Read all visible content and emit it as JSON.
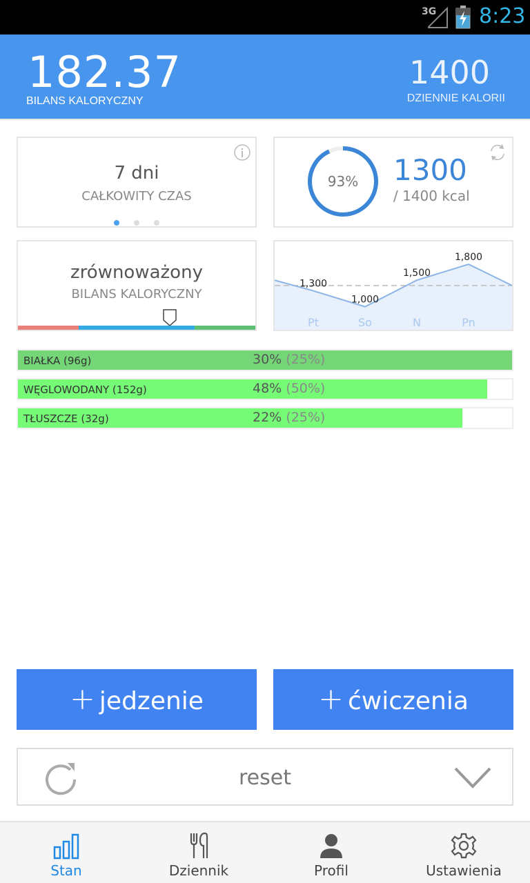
{
  "status_bar": {
    "network": "3G",
    "time": "8:23"
  },
  "header": {
    "balance_value": "182.37",
    "balance_label": "BILANS KALORYCZNY",
    "daily_value": "1400",
    "daily_label": "DZIENNIE KALORII"
  },
  "card_time": {
    "value": "7 dni",
    "label": "CAŁKOWITY CZAS",
    "page_index": 0,
    "page_count": 3
  },
  "card_calories": {
    "percent": "93%",
    "percent_fraction": 0.93,
    "consumed": "1300",
    "limit": "/ 1400 kcal"
  },
  "card_balance": {
    "status": "zrównoważony",
    "label": "BILANS KALORYCZNY",
    "scale_colors": [
      "#ea7f7b",
      "#35a9e2",
      "#5fbf72"
    ]
  },
  "chart_data": {
    "type": "line",
    "categories": [
      "Pt",
      "So",
      "N",
      "Pn"
    ],
    "values": [
      1300,
      1000,
      1500,
      1800
    ],
    "data_labels": [
      "1,300",
      "1,000",
      "1,500",
      "1,800"
    ],
    "target": 1400,
    "fill_color": "#e8f0fb",
    "line_color": "#8ab4e6"
  },
  "macros": [
    {
      "name": "BIAŁKA (96g)",
      "percent": "30%",
      "target": "(25%)",
      "fill_fraction": 1.0,
      "color": "#74d677"
    },
    {
      "name": "WĘGLOWODANY (152g)",
      "percent": "48%",
      "target": "(50%)",
      "fill_fraction": 0.95,
      "color": "#76fb77"
    },
    {
      "name": "TŁUSZCZE (32g)",
      "percent": "22%",
      "target": "(25%)",
      "fill_fraction": 0.9,
      "color": "#76fb77"
    }
  ],
  "actions": {
    "food_label": "jedzenie",
    "exercise_label": "ćwiczenia",
    "plus": "+",
    "color": "#4183f0"
  },
  "reset": {
    "label": "reset"
  },
  "nav": [
    {
      "label": "Stan",
      "icon": "bar-chart-icon",
      "active": true
    },
    {
      "label": "Dziennik",
      "icon": "fork-knife-icon",
      "active": false
    },
    {
      "label": "Profil",
      "icon": "person-icon",
      "active": false
    },
    {
      "label": "Ustawienia",
      "icon": "gear-icon",
      "active": false
    }
  ]
}
